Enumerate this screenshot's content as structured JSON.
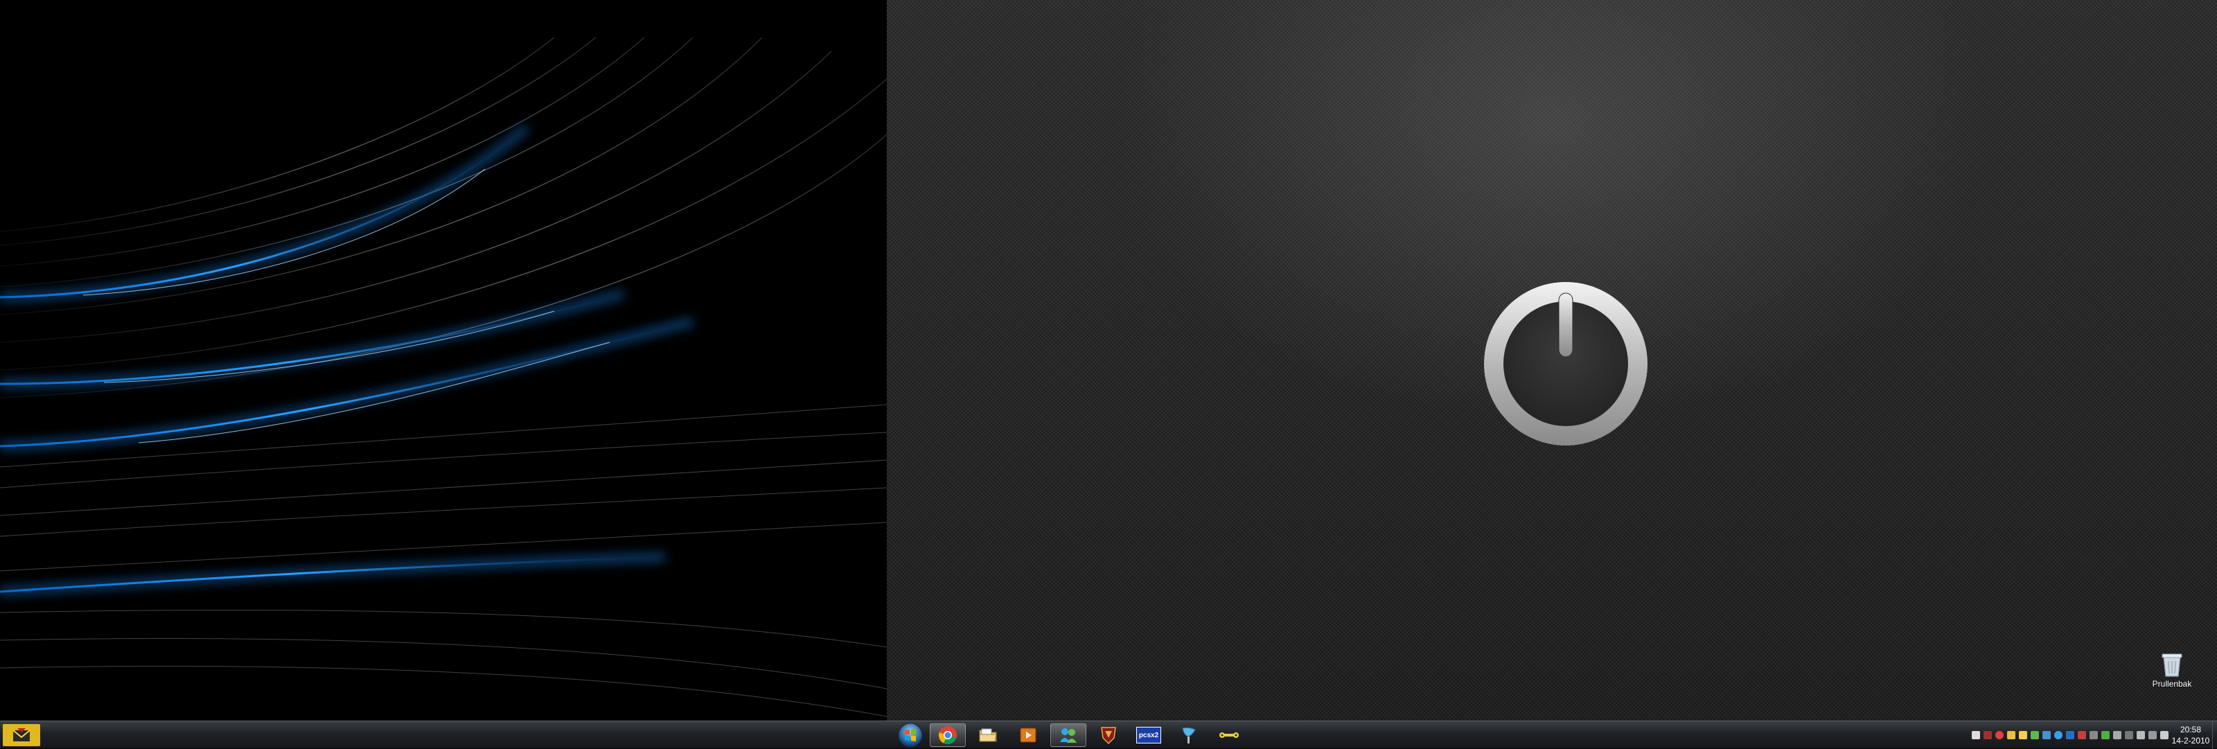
{
  "desktop": {
    "recycle_bin_label": "Prullenbak"
  },
  "taskbar": {
    "start_icon": "windows-orb-icon",
    "left_app_icon": "mail-envelope-icon",
    "pinned_apps": [
      {
        "name": "chrome-icon",
        "active": true
      },
      {
        "name": "folder-icon",
        "active": false
      },
      {
        "name": "media-player-icon",
        "active": false
      },
      {
        "name": "messenger-icon",
        "active": true
      },
      {
        "name": "shield-game-icon",
        "active": false
      },
      {
        "name": "pcsx-emulator-icon",
        "active": false,
        "text": "pcsx2"
      },
      {
        "name": "paint-brush-icon",
        "active": false
      },
      {
        "name": "wrench-tool-icon",
        "active": false
      }
    ],
    "clock": {
      "time": "20:58",
      "date": "14-2-2010"
    }
  },
  "colors": {
    "accent_blue": "#1e90ff",
    "taskbar_dark": "#1f2226",
    "left_app_yellow": "#e0b820"
  }
}
